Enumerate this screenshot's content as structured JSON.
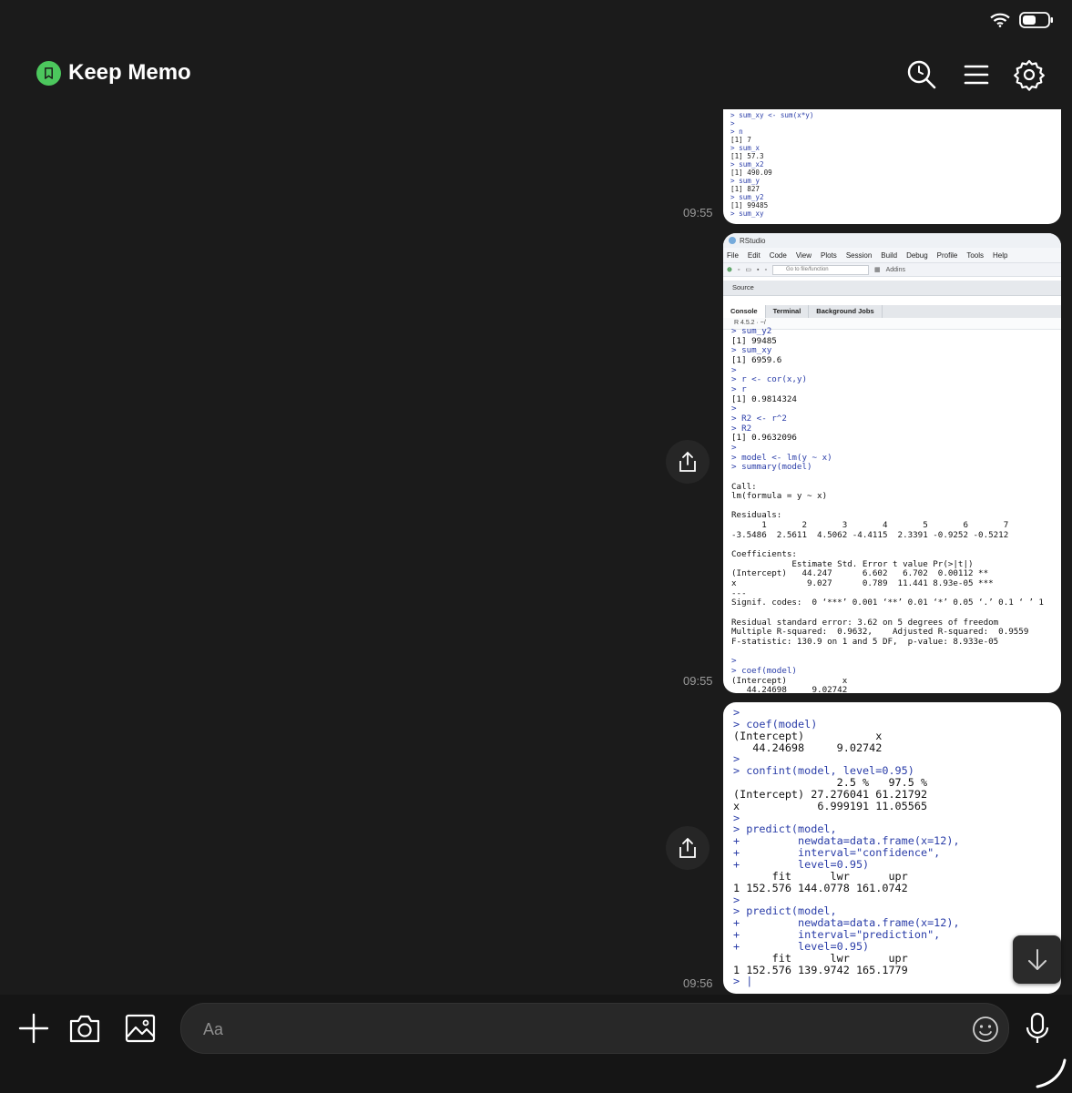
{
  "app": {
    "title": "Keep Memo",
    "brand_color": "#4cc75d",
    "icons": {
      "search": "search-icon",
      "menu": "menu-icon",
      "settings": "gear-icon",
      "brand": "bookmark-icon"
    }
  },
  "status_bar": {
    "wifi": "wifi-icon",
    "battery": "battery-icon"
  },
  "messages": [
    {
      "time": "09:55",
      "console_lines": [
        "> sum_xy <- sum(x*y)",
        ">",
        "> n",
        "[1] 7",
        "> sum_x",
        "[1] 57.3",
        "> sum_x2",
        "[1] 490.09",
        "> sum_y",
        "[1] 827",
        "> sum_y2",
        "[1] 99485",
        "> sum_xy"
      ]
    },
    {
      "time": "09:55",
      "rstudio": {
        "window_title": "RStudio",
        "menu": [
          "File",
          "Edit",
          "Code",
          "View",
          "Plots",
          "Session",
          "Build",
          "Debug",
          "Profile",
          "Tools",
          "Help"
        ],
        "goto_placeholder": "Go to file/function",
        "addins": "Addins",
        "source_label": "Source",
        "tabs": [
          "Console",
          "Terminal",
          "Background Jobs"
        ],
        "r_version": "R 4.5.2 · ~/"
      },
      "console_lines": [
        "> sum_y2",
        "[1] 99485",
        "> sum_xy",
        "[1] 6959.6",
        ">",
        "> r <- cor(x,y)",
        "> r",
        "[1] 0.9814324",
        ">",
        "> R2 <- r^2",
        "> R2",
        "[1] 0.9632096",
        ">",
        "> model <- lm(y ~ x)",
        "> summary(model)",
        "",
        "Call:",
        "lm(formula = y ~ x)",
        "",
        "Residuals:",
        "      1       2       3       4       5       6       7",
        "-3.5486  2.5611  4.5062 -4.4115  2.3391 -0.9252 -0.5212",
        "",
        "Coefficients:",
        "            Estimate Std. Error t value Pr(>|t|)",
        "(Intercept)   44.247      6.602   6.702  0.00112 **",
        "x              9.027      0.789  11.441 8.93e-05 ***",
        "---",
        "Signif. codes:  0 ‘***’ 0.001 ‘**’ 0.01 ‘*’ 0.05 ‘.’ 0.1 ‘ ’ 1",
        "",
        "Residual standard error: 3.62 on 5 degrees of freedom",
        "Multiple R-squared:  0.9632,    Adjusted R-squared:  0.9559",
        "F-statistic: 130.9 on 1 and 5 DF,  p-value: 8.933e-05",
        "",
        ">",
        "> coef(model)",
        "(Intercept)           x",
        "   44.24698     9.02742"
      ]
    },
    {
      "time": "09:56",
      "console_lines": [
        ">",
        "> coef(model)",
        "(Intercept)           x",
        "   44.24698     9.02742",
        ">",
        "> confint(model, level=0.95)",
        "                2.5 %   97.5 %",
        "(Intercept) 27.276041 61.21792",
        "x            6.999191 11.05565",
        ">",
        "> predict(model,",
        "+         newdata=data.frame(x=12),",
        "+         interval=\"confidence\",",
        "+         level=0.95)",
        "      fit      lwr      upr",
        "1 152.576 144.0778 161.0742",
        ">",
        "> predict(model,",
        "+         newdata=data.frame(x=12),",
        "+         interval=\"prediction\",",
        "+         level=0.95)",
        "      fit      lwr      upr",
        "1 152.576 139.9742 165.1779",
        "> |"
      ]
    }
  ],
  "composer": {
    "placeholder": "Aa"
  },
  "toolbar_icons": [
    "plus-icon",
    "camera-icon",
    "image-icon",
    "emoji-icon",
    "microphone-icon"
  ]
}
